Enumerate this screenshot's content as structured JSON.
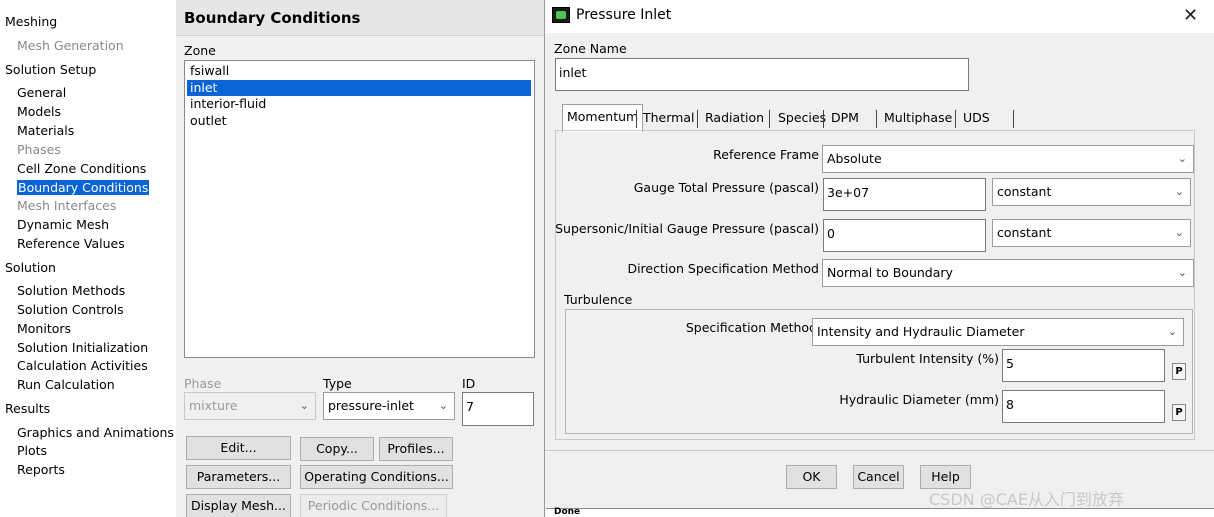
{
  "tree": {
    "items": [
      {
        "label": "Meshing",
        "level": 0,
        "state": "normal"
      },
      {
        "label": "Mesh Generation",
        "level": 1,
        "state": "disabled"
      },
      {
        "label": "Solution Setup",
        "level": 0,
        "state": "normal"
      },
      {
        "label": "General",
        "level": 1,
        "state": "normal"
      },
      {
        "label": "Models",
        "level": 1,
        "state": "normal"
      },
      {
        "label": "Materials",
        "level": 1,
        "state": "normal"
      },
      {
        "label": "Phases",
        "level": 1,
        "state": "disabled"
      },
      {
        "label": "Cell Zone Conditions",
        "level": 1,
        "state": "normal"
      },
      {
        "label": "Boundary Conditions",
        "level": 1,
        "state": "selected"
      },
      {
        "label": "Mesh Interfaces",
        "level": 1,
        "state": "disabled"
      },
      {
        "label": "Dynamic Mesh",
        "level": 1,
        "state": "normal"
      },
      {
        "label": "Reference Values",
        "level": 1,
        "state": "normal"
      },
      {
        "label": "Solution",
        "level": 0,
        "state": "normal"
      },
      {
        "label": "Solution Methods",
        "level": 1,
        "state": "normal"
      },
      {
        "label": "Solution Controls",
        "level": 1,
        "state": "normal"
      },
      {
        "label": "Monitors",
        "level": 1,
        "state": "normal"
      },
      {
        "label": "Solution Initialization",
        "level": 1,
        "state": "normal"
      },
      {
        "label": "Calculation Activities",
        "level": 1,
        "state": "normal"
      },
      {
        "label": "Run Calculation",
        "level": 1,
        "state": "normal"
      },
      {
        "label": "Results",
        "level": 0,
        "state": "normal"
      },
      {
        "label": "Graphics and Animations",
        "level": 1,
        "state": "normal"
      },
      {
        "label": "Plots",
        "level": 1,
        "state": "normal"
      },
      {
        "label": "Reports",
        "level": 1,
        "state": "normal"
      }
    ]
  },
  "bc": {
    "title": "Boundary Conditions",
    "zone_label": "Zone",
    "zones": [
      {
        "name": "fsiwall",
        "selected": false
      },
      {
        "name": "inlet",
        "selected": true
      },
      {
        "name": "interior-fluid",
        "selected": false
      },
      {
        "name": "outlet",
        "selected": false
      }
    ],
    "phase_label": "Phase",
    "phase_value": "mixture",
    "type_label": "Type",
    "type_value": "pressure-inlet",
    "id_label": "ID",
    "id_value": "7",
    "buttons": {
      "edit": "Edit...",
      "copy": "Copy...",
      "profiles": "Profiles...",
      "parameters": "Parameters...",
      "operating": "Operating Conditions...",
      "display_mesh": "Display Mesh...",
      "periodic": "Periodic Conditions..."
    }
  },
  "dialog": {
    "title": "Pressure Inlet",
    "zone_name_label": "Zone Name",
    "zone_name_value": "inlet",
    "tabs": [
      {
        "label": "Momentum",
        "active": true
      },
      {
        "label": "Thermal",
        "active": false
      },
      {
        "label": "Radiation",
        "active": false
      },
      {
        "label": "Species",
        "active": false
      },
      {
        "label": "DPM",
        "active": false
      },
      {
        "label": "Multiphase",
        "active": false
      },
      {
        "label": "UDS",
        "active": false
      }
    ],
    "reference_frame_label": "Reference Frame",
    "reference_frame_value": "Absolute",
    "gauge_total_label": "Gauge Total Pressure (pascal)",
    "gauge_total_value": "3e+07",
    "gauge_total_method": "constant",
    "supersonic_label": "Supersonic/Initial Gauge Pressure (pascal)",
    "supersonic_value": "0",
    "supersonic_method": "constant",
    "direction_label": "Direction Specification Method",
    "direction_value": "Normal to Boundary",
    "turbulence_label": "Turbulence",
    "spec_method_label": "Specification Method",
    "spec_method_value": "Intensity and Hydraulic Diameter",
    "intensity_label": "Turbulent Intensity (%)",
    "intensity_value": "5",
    "hydraulic_label": "Hydraulic Diameter (mm)",
    "hydraulic_value": "8",
    "param_button": "P",
    "ok": "OK",
    "cancel": "Cancel",
    "help": "Help"
  },
  "watermark": "CSDN @CAE从入门到放弃",
  "status_text": "Done"
}
